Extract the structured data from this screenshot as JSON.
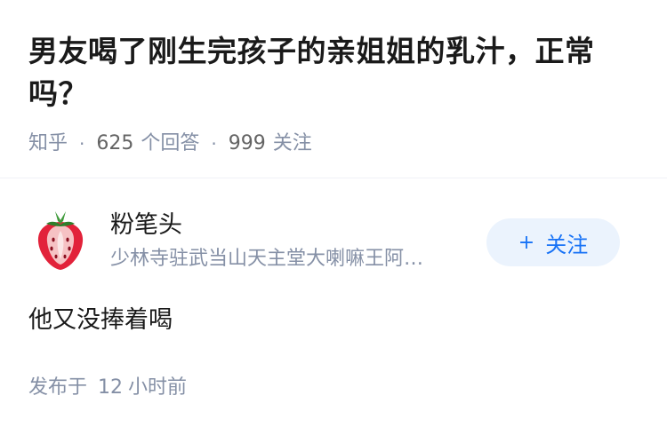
{
  "question": {
    "title": "男友喝了刚生完孩子的亲姐姐的乳汁，正常吗？",
    "source": "知乎",
    "answer_count": "625",
    "answer_label": "个回答",
    "follower_count": "999",
    "follower_label": "关注"
  },
  "author": {
    "name": "粉笔头",
    "bio": "少林寺驻武当山天主堂大喇嘛王阿…",
    "avatar_icon": "strawberry-icon",
    "follow_button": {
      "plus": "+",
      "label": "关注"
    }
  },
  "answer": {
    "text": "他又没捧着喝"
  },
  "published": {
    "prefix": "发布于",
    "number": "12",
    "unit": "小时前"
  },
  "colors": {
    "accent": "#1772f6",
    "button_bg": "#ebf3fd",
    "meta_gray": "#8590a6",
    "strawberry": "#e2223a"
  }
}
